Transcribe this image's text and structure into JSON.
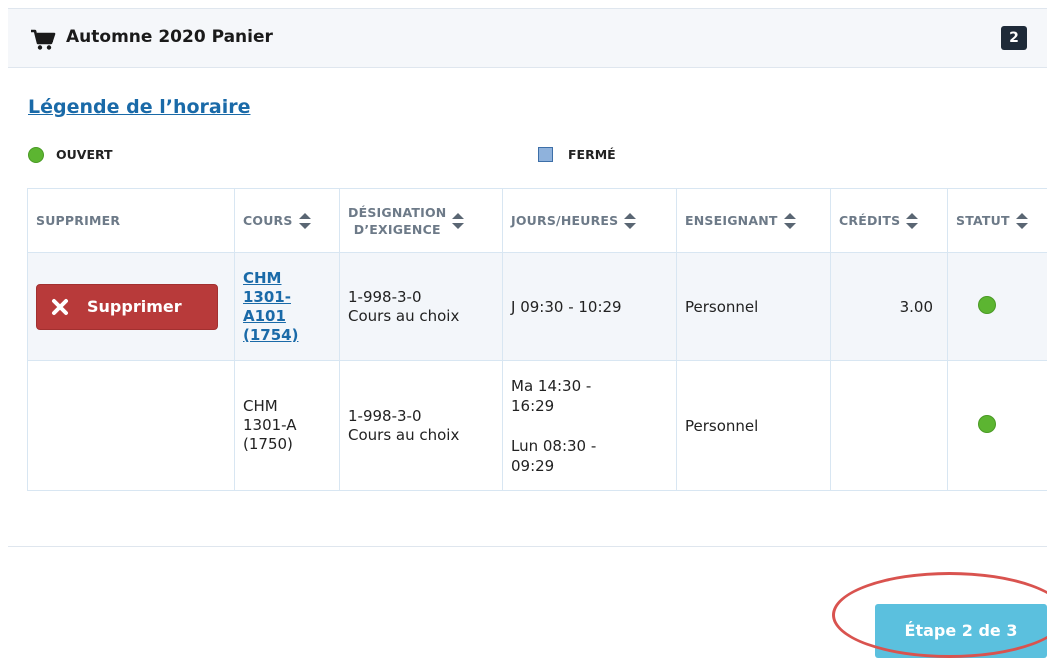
{
  "cart": {
    "title": "Automne 2020 Panier",
    "count": "2"
  },
  "legend": {
    "link_label": "Légende de l’horaire",
    "open_label": "OUVERT",
    "closed_label": "FERMÉ",
    "open_color": "#5cb531",
    "closed_color": "#8fb2dc"
  },
  "table": {
    "headers": {
      "remove": "SUPPRIMER",
      "course": "COURS",
      "requirement_line1": "DÉSIGNATION",
      "requirement_line2": "D’EXIGENCE",
      "schedule": "JOURS/HEURES",
      "instructor": "ENSEIGNANT",
      "credits": "CRÉDITS",
      "status": "STATUT"
    },
    "rows": [
      {
        "remove_label": "Supprimer",
        "course_lines": [
          "CHM",
          "1301-",
          "A101",
          "(1754)"
        ],
        "requirement_lines": [
          "1-998-3-0",
          "Cours au choix"
        ],
        "schedule_lines": [
          "J 09:30 - 10:29"
        ],
        "instructor": "Personnel",
        "credits": "3.00",
        "status": "open"
      },
      {
        "course_lines": [
          "CHM",
          "1301-A",
          "(1750)"
        ],
        "requirement_lines": [
          "1-998-3-0",
          "Cours au choix"
        ],
        "schedule_block1": [
          "Ma 14:30 -",
          "16:29"
        ],
        "schedule_block2": [
          "Lun 08:30 -",
          "09:29"
        ],
        "instructor": "Personnel",
        "credits": "",
        "status": "open"
      }
    ]
  },
  "footer": {
    "step_label": "Étape 2 de 3",
    "step_color": "#5bc0de",
    "highlight_color": "#d9534f"
  },
  "colors": {
    "remove_button": "#b83a3a",
    "link": "#1a6aa8",
    "count_badge": "#1e2a38"
  }
}
